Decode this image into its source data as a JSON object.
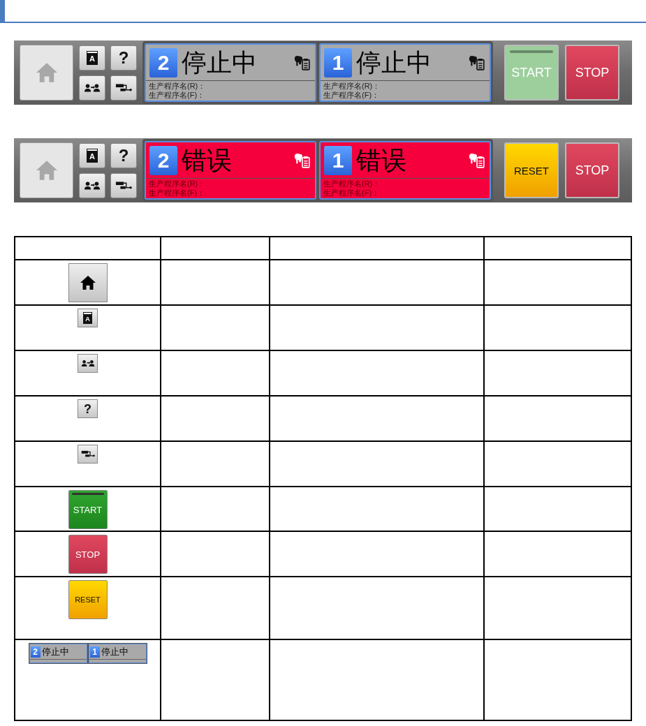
{
  "panels": [
    {
      "error": false,
      "home": {
        "enabled": false
      },
      "tools": [
        {
          "kind": "book",
          "glyph": "A"
        },
        {
          "kind": "help",
          "glyph": "?"
        },
        {
          "kind": "users"
        },
        {
          "kind": "network"
        }
      ],
      "lanes": [
        {
          "number": "2",
          "status": "停止中",
          "program_r": "生产程序名(R)：",
          "program_f": "生产程序名(F)："
        },
        {
          "number": "1",
          "status": "停止中",
          "program_r": "生产程序名(R)：",
          "program_f": "生产程序名(F)："
        }
      ],
      "actions": [
        {
          "kind": "start",
          "label": "START",
          "enabled": false
        },
        {
          "kind": "stop",
          "label": "STOP",
          "enabled": true
        }
      ]
    },
    {
      "error": true,
      "home": {
        "enabled": false
      },
      "tools": [
        {
          "kind": "book",
          "glyph": "A"
        },
        {
          "kind": "help",
          "glyph": "?"
        },
        {
          "kind": "users"
        },
        {
          "kind": "network"
        }
      ],
      "lanes": [
        {
          "number": "2",
          "status": "错误",
          "program_r": "生产程序名(R)：",
          "program_f": "生产程序名(F)："
        },
        {
          "number": "1",
          "status": "错误",
          "program_r": "生产程序名(R)：",
          "program_f": "生产程序名(F)："
        }
      ],
      "actions": [
        {
          "kind": "reset",
          "label": "RESET",
          "enabled": true
        },
        {
          "kind": "stop",
          "label": "STOP",
          "enabled": true
        }
      ]
    }
  ],
  "table": {
    "rows": [
      {
        "kind": "home"
      },
      {
        "kind": "book",
        "glyph": "A"
      },
      {
        "kind": "users"
      },
      {
        "kind": "help",
        "glyph": "?"
      },
      {
        "kind": "network"
      },
      {
        "kind": "start",
        "label": "START"
      },
      {
        "kind": "stop",
        "label": "STOP"
      },
      {
        "kind": "reset",
        "label": "RESET"
      },
      {
        "kind": "lanes",
        "lanes": [
          {
            "number": "2",
            "status": "停止中"
          },
          {
            "number": "1",
            "status": "停止中"
          }
        ]
      }
    ]
  }
}
